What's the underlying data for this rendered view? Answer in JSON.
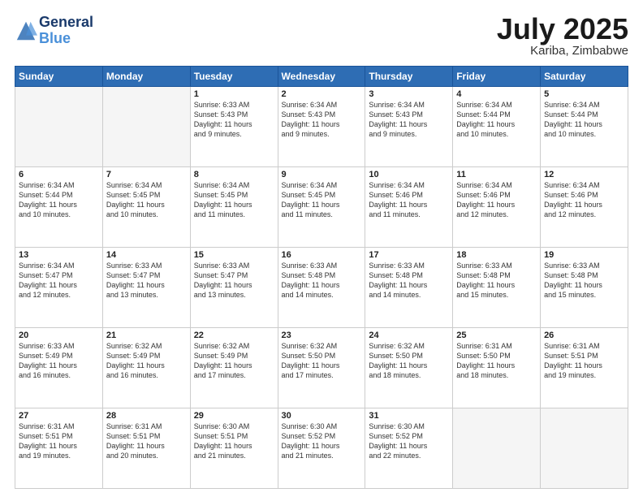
{
  "logo": {
    "line1": "General",
    "line2": "Blue"
  },
  "title": "July 2025",
  "location": "Kariba, Zimbabwe",
  "days_header": [
    "Sunday",
    "Monday",
    "Tuesday",
    "Wednesday",
    "Thursday",
    "Friday",
    "Saturday"
  ],
  "weeks": [
    [
      {
        "day": "",
        "info": ""
      },
      {
        "day": "",
        "info": ""
      },
      {
        "day": "1",
        "info": "Sunrise: 6:33 AM\nSunset: 5:43 PM\nDaylight: 11 hours\nand 9 minutes."
      },
      {
        "day": "2",
        "info": "Sunrise: 6:34 AM\nSunset: 5:43 PM\nDaylight: 11 hours\nand 9 minutes."
      },
      {
        "day": "3",
        "info": "Sunrise: 6:34 AM\nSunset: 5:43 PM\nDaylight: 11 hours\nand 9 minutes."
      },
      {
        "day": "4",
        "info": "Sunrise: 6:34 AM\nSunset: 5:44 PM\nDaylight: 11 hours\nand 10 minutes."
      },
      {
        "day": "5",
        "info": "Sunrise: 6:34 AM\nSunset: 5:44 PM\nDaylight: 11 hours\nand 10 minutes."
      }
    ],
    [
      {
        "day": "6",
        "info": "Sunrise: 6:34 AM\nSunset: 5:44 PM\nDaylight: 11 hours\nand 10 minutes."
      },
      {
        "day": "7",
        "info": "Sunrise: 6:34 AM\nSunset: 5:45 PM\nDaylight: 11 hours\nand 10 minutes."
      },
      {
        "day": "8",
        "info": "Sunrise: 6:34 AM\nSunset: 5:45 PM\nDaylight: 11 hours\nand 11 minutes."
      },
      {
        "day": "9",
        "info": "Sunrise: 6:34 AM\nSunset: 5:45 PM\nDaylight: 11 hours\nand 11 minutes."
      },
      {
        "day": "10",
        "info": "Sunrise: 6:34 AM\nSunset: 5:46 PM\nDaylight: 11 hours\nand 11 minutes."
      },
      {
        "day": "11",
        "info": "Sunrise: 6:34 AM\nSunset: 5:46 PM\nDaylight: 11 hours\nand 12 minutes."
      },
      {
        "day": "12",
        "info": "Sunrise: 6:34 AM\nSunset: 5:46 PM\nDaylight: 11 hours\nand 12 minutes."
      }
    ],
    [
      {
        "day": "13",
        "info": "Sunrise: 6:34 AM\nSunset: 5:47 PM\nDaylight: 11 hours\nand 12 minutes."
      },
      {
        "day": "14",
        "info": "Sunrise: 6:33 AM\nSunset: 5:47 PM\nDaylight: 11 hours\nand 13 minutes."
      },
      {
        "day": "15",
        "info": "Sunrise: 6:33 AM\nSunset: 5:47 PM\nDaylight: 11 hours\nand 13 minutes."
      },
      {
        "day": "16",
        "info": "Sunrise: 6:33 AM\nSunset: 5:48 PM\nDaylight: 11 hours\nand 14 minutes."
      },
      {
        "day": "17",
        "info": "Sunrise: 6:33 AM\nSunset: 5:48 PM\nDaylight: 11 hours\nand 14 minutes."
      },
      {
        "day": "18",
        "info": "Sunrise: 6:33 AM\nSunset: 5:48 PM\nDaylight: 11 hours\nand 15 minutes."
      },
      {
        "day": "19",
        "info": "Sunrise: 6:33 AM\nSunset: 5:48 PM\nDaylight: 11 hours\nand 15 minutes."
      }
    ],
    [
      {
        "day": "20",
        "info": "Sunrise: 6:33 AM\nSunset: 5:49 PM\nDaylight: 11 hours\nand 16 minutes."
      },
      {
        "day": "21",
        "info": "Sunrise: 6:32 AM\nSunset: 5:49 PM\nDaylight: 11 hours\nand 16 minutes."
      },
      {
        "day": "22",
        "info": "Sunrise: 6:32 AM\nSunset: 5:49 PM\nDaylight: 11 hours\nand 17 minutes."
      },
      {
        "day": "23",
        "info": "Sunrise: 6:32 AM\nSunset: 5:50 PM\nDaylight: 11 hours\nand 17 minutes."
      },
      {
        "day": "24",
        "info": "Sunrise: 6:32 AM\nSunset: 5:50 PM\nDaylight: 11 hours\nand 18 minutes."
      },
      {
        "day": "25",
        "info": "Sunrise: 6:31 AM\nSunset: 5:50 PM\nDaylight: 11 hours\nand 18 minutes."
      },
      {
        "day": "26",
        "info": "Sunrise: 6:31 AM\nSunset: 5:51 PM\nDaylight: 11 hours\nand 19 minutes."
      }
    ],
    [
      {
        "day": "27",
        "info": "Sunrise: 6:31 AM\nSunset: 5:51 PM\nDaylight: 11 hours\nand 19 minutes."
      },
      {
        "day": "28",
        "info": "Sunrise: 6:31 AM\nSunset: 5:51 PM\nDaylight: 11 hours\nand 20 minutes."
      },
      {
        "day": "29",
        "info": "Sunrise: 6:30 AM\nSunset: 5:51 PM\nDaylight: 11 hours\nand 21 minutes."
      },
      {
        "day": "30",
        "info": "Sunrise: 6:30 AM\nSunset: 5:52 PM\nDaylight: 11 hours\nand 21 minutes."
      },
      {
        "day": "31",
        "info": "Sunrise: 6:30 AM\nSunset: 5:52 PM\nDaylight: 11 hours\nand 22 minutes."
      },
      {
        "day": "",
        "info": ""
      },
      {
        "day": "",
        "info": ""
      }
    ]
  ]
}
